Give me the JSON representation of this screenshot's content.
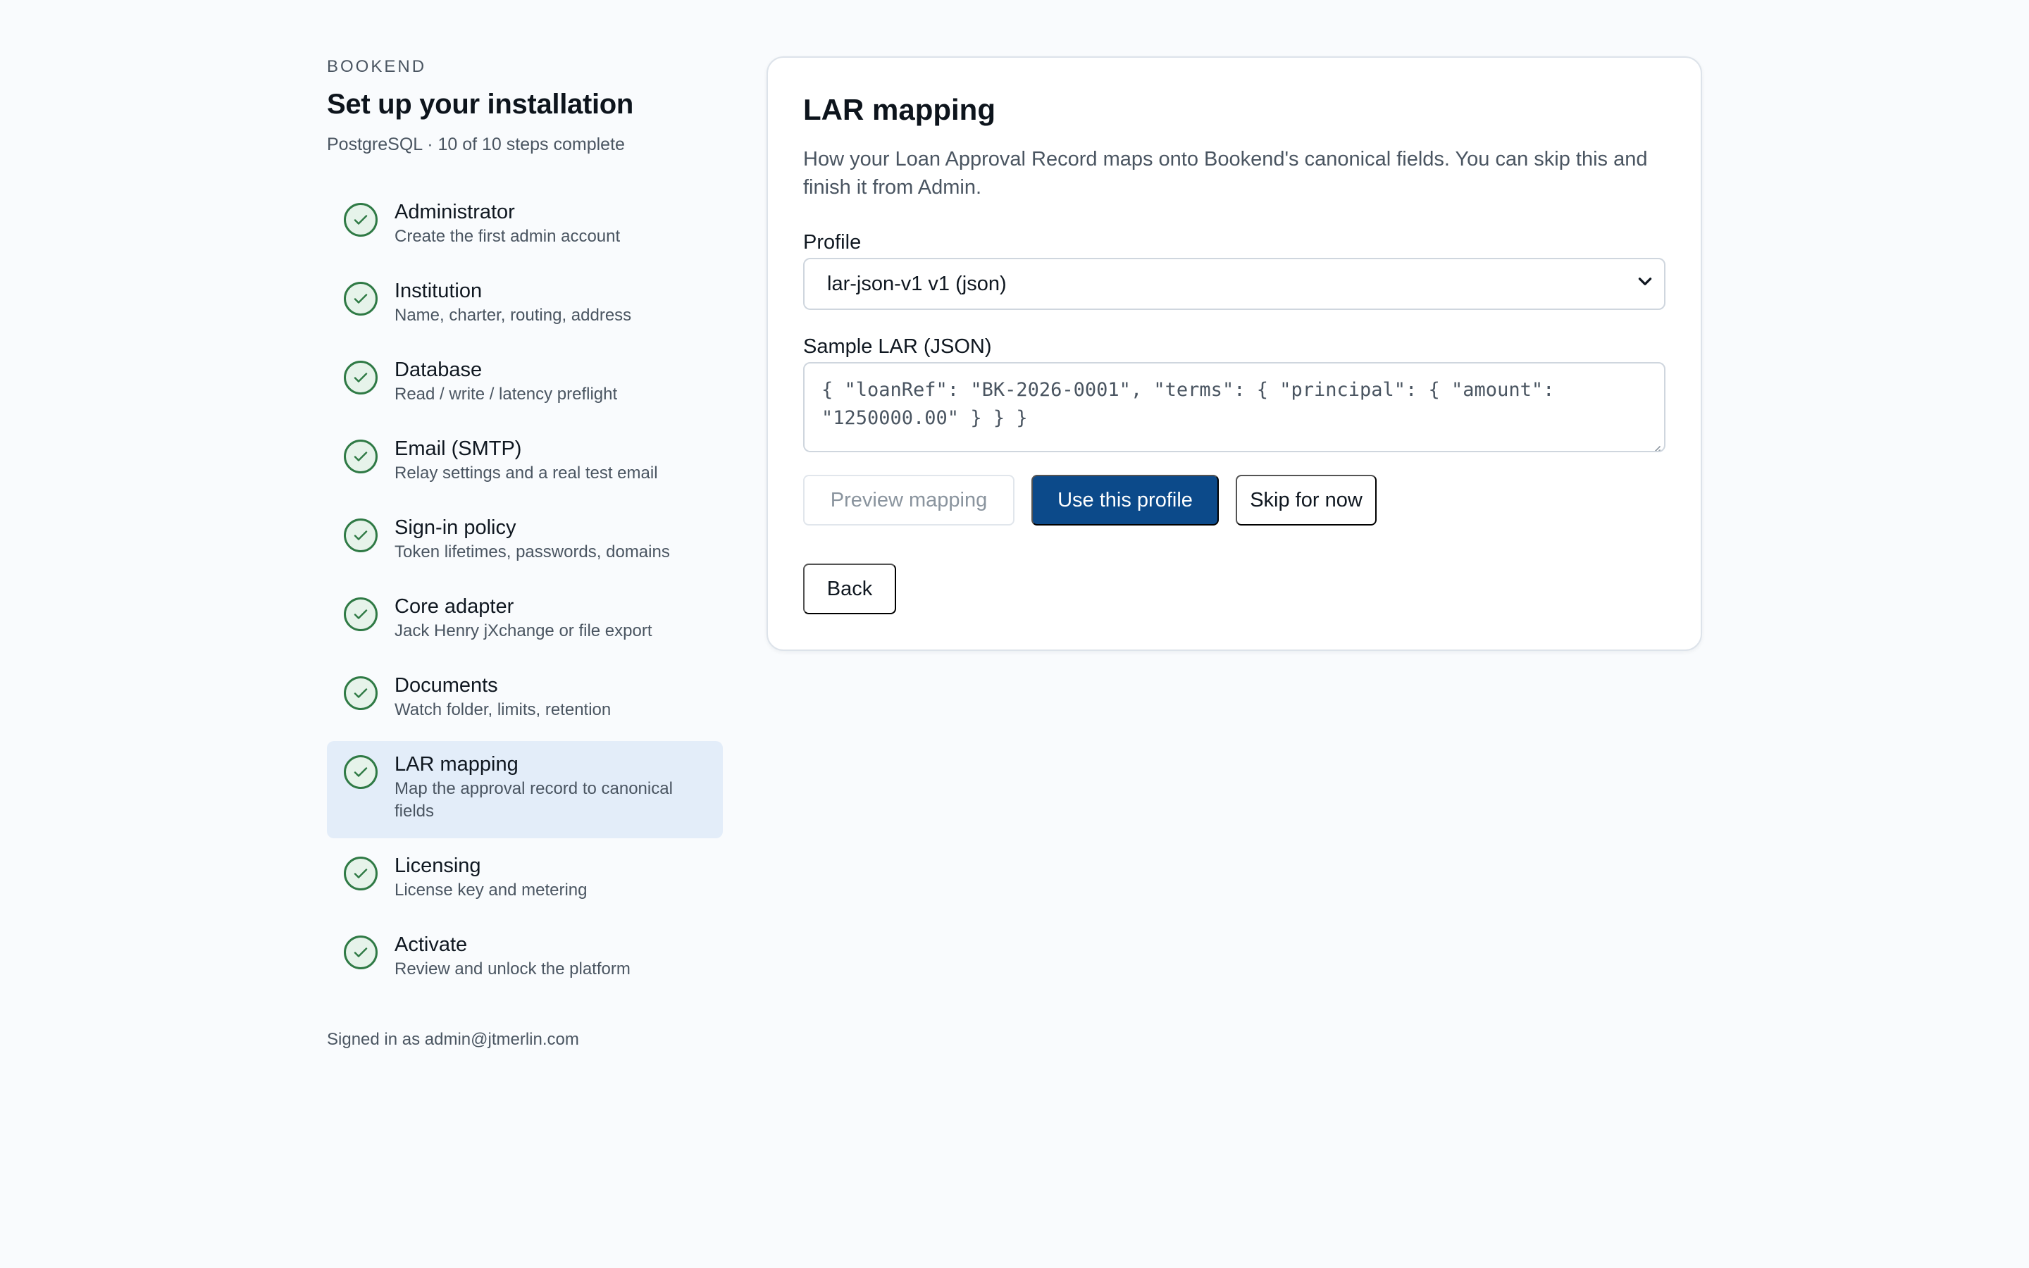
{
  "sidebar": {
    "brand": "BOOKEND",
    "title": "Set up your installation",
    "subtitle": "PostgreSQL · 10 of 10 steps complete",
    "steps": [
      {
        "title": "Administrator",
        "desc": "Create the first admin account",
        "status": "complete",
        "active": false
      },
      {
        "title": "Institution",
        "desc": "Name, charter, routing, address",
        "status": "complete",
        "active": false
      },
      {
        "title": "Database",
        "desc": "Read / write / latency preflight",
        "status": "complete",
        "active": false
      },
      {
        "title": "Email (SMTP)",
        "desc": "Relay settings and a real test email",
        "status": "complete",
        "active": false
      },
      {
        "title": "Sign-in policy",
        "desc": "Token lifetimes, passwords, domains",
        "status": "complete",
        "active": false
      },
      {
        "title": "Core adapter",
        "desc": "Jack Henry jXchange or file export",
        "status": "complete",
        "active": false
      },
      {
        "title": "Documents",
        "desc": "Watch folder, limits, retention",
        "status": "complete",
        "active": false
      },
      {
        "title": "LAR mapping",
        "desc": "Map the approval record to canonical fields",
        "status": "complete",
        "active": true
      },
      {
        "title": "Licensing",
        "desc": "License key and metering",
        "status": "complete",
        "active": false
      },
      {
        "title": "Activate",
        "desc": "Review and unlock the platform",
        "status": "complete",
        "active": false
      }
    ],
    "signed_in": "Signed in as admin@jtmerlin.com"
  },
  "main": {
    "title": "LAR mapping",
    "description": "How your Loan Approval Record maps onto Bookend's canonical fields. You can skip this and finish it from Admin.",
    "profile": {
      "label": "Profile",
      "selected": "lar-json-v1 v1 (json)"
    },
    "sample": {
      "label": "Sample LAR (JSON)",
      "value": "{ \"loanRef\": \"BK-2026-0001\", \"terms\": { \"principal\": { \"amount\":\n\"1250000.00\" } } }"
    },
    "buttons": {
      "preview": "Preview mapping",
      "use": "Use this profile",
      "skip": "Skip for now",
      "back": "Back"
    }
  },
  "colors": {
    "primary": "#0c4a8a",
    "check": "#2f7a45",
    "active_bg": "#e3edf9",
    "page_bg": "#f9fbfd"
  },
  "icons": {
    "step_status": "check-circle-icon",
    "select": "chevron-down-icon"
  }
}
